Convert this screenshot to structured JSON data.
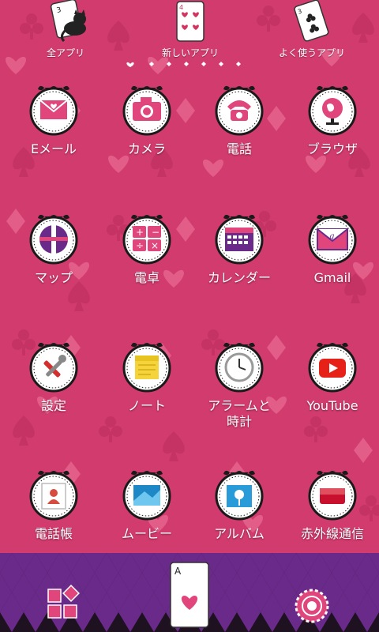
{
  "colors": {
    "background": "#d23b6e",
    "dock_purple": "#6a2a8a",
    "dock_dark": "#1e1220",
    "accent_pink": "#e0457c"
  },
  "top_cards": [
    {
      "label": "全アプリ",
      "icon": "cheshire-cat-card-icon"
    },
    {
      "label": "新しいアプリ",
      "icon": "four-of-hearts-card-icon"
    },
    {
      "label": "よく使うアプリ",
      "icon": "three-of-clubs-card-icon"
    }
  ],
  "page_indicator": {
    "count": 7,
    "current": 0
  },
  "apps": [
    {
      "label": "Eメール",
      "icon": "envelope-heart-icon"
    },
    {
      "label": "カメラ",
      "icon": "camera-icon"
    },
    {
      "label": "電話",
      "icon": "telephone-icon"
    },
    {
      "label": "ブラウザ",
      "icon": "globe-icon"
    },
    {
      "label": "マップ",
      "icon": "map-icon"
    },
    {
      "label": "電卓",
      "icon": "calculator-icon"
    },
    {
      "label": "カレンダー",
      "icon": "calendar-icon"
    },
    {
      "label": "Gmail",
      "icon": "gmail-envelope-icon"
    },
    {
      "label": "設定",
      "icon": "tools-icon"
    },
    {
      "label": "ノート",
      "icon": "note-icon"
    },
    {
      "label": "アラームと\n時計",
      "icon": "clock-icon"
    },
    {
      "label": "YouTube",
      "icon": "youtube-play-icon"
    },
    {
      "label": "電話帳",
      "icon": "contacts-icon"
    },
    {
      "label": "ムービー",
      "icon": "movie-icon"
    },
    {
      "label": "アルバム",
      "icon": "photo-album-icon"
    },
    {
      "label": "赤外線通信",
      "icon": "infrared-icon"
    }
  ],
  "dock": {
    "left": {
      "icon": "app-drawer-squares-icon"
    },
    "center": {
      "card_rank": "A",
      "icon": "ace-of-hearts-card-icon"
    },
    "right": {
      "icon": "gear-settings-icon"
    }
  }
}
